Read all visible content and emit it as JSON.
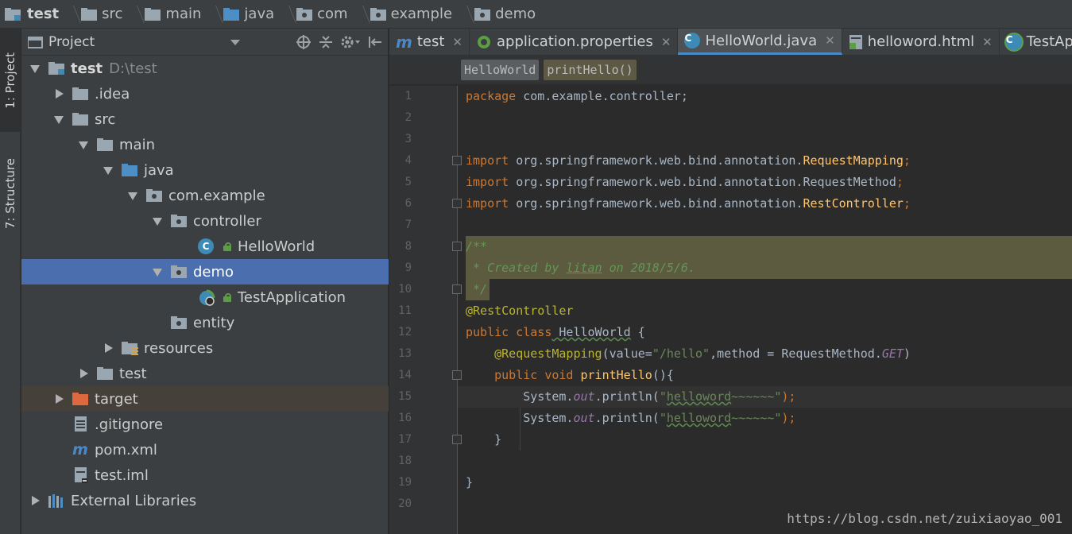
{
  "breadcrumb": [
    {
      "label": "test",
      "icon": "module-folder-icon"
    },
    {
      "label": "src",
      "icon": "folder-icon"
    },
    {
      "label": "main",
      "icon": "folder-icon"
    },
    {
      "label": "java",
      "icon": "source-folder-icon"
    },
    {
      "label": "com",
      "icon": "package-icon"
    },
    {
      "label": "example",
      "icon": "package-icon"
    },
    {
      "label": "demo",
      "icon": "package-icon"
    }
  ],
  "tool_strip": {
    "project_tab": "1: Project",
    "structure_tab": "7: Structure"
  },
  "project_panel": {
    "title": "Project",
    "tree": [
      {
        "label": "test",
        "extra": "D:\\test",
        "depth": 0,
        "arrow": "down",
        "icon": "module",
        "bold": true
      },
      {
        "label": ".idea",
        "depth": 1,
        "arrow": "right",
        "icon": "folder"
      },
      {
        "label": "src",
        "depth": 1,
        "arrow": "down",
        "icon": "folder"
      },
      {
        "label": "main",
        "depth": 2,
        "arrow": "down",
        "icon": "folder"
      },
      {
        "label": "java",
        "depth": 3,
        "arrow": "down",
        "icon": "source-folder"
      },
      {
        "label": "com.example",
        "depth": 4,
        "arrow": "down",
        "icon": "package"
      },
      {
        "label": "controller",
        "depth": 5,
        "arrow": "down",
        "icon": "package"
      },
      {
        "label": "HelloWorld",
        "depth": 6,
        "arrow": "none",
        "icon": "class"
      },
      {
        "label": "demo",
        "depth": 5,
        "arrow": "down",
        "icon": "package",
        "selected": true
      },
      {
        "label": "TestApplication",
        "depth": 6,
        "arrow": "none",
        "icon": "spring-boot-class"
      },
      {
        "label": "entity",
        "depth": 5,
        "arrow": "none",
        "icon": "package"
      },
      {
        "label": "resources",
        "depth": 3,
        "arrow": "right",
        "icon": "resources-folder"
      },
      {
        "label": "test",
        "depth": 2,
        "arrow": "right",
        "icon": "folder"
      },
      {
        "label": "target",
        "depth": 1,
        "arrow": "right",
        "icon": "excluded-folder",
        "excluded": true
      },
      {
        "label": ".gitignore",
        "depth": 1,
        "arrow": "none",
        "icon": "text-file"
      },
      {
        "label": "pom.xml",
        "depth": 1,
        "arrow": "none",
        "icon": "maven-file"
      },
      {
        "label": "test.iml",
        "depth": 1,
        "arrow": "none",
        "icon": "iml-file"
      },
      {
        "label": "External Libraries",
        "depth": 0,
        "arrow": "right",
        "icon": "libraries"
      }
    ]
  },
  "editor": {
    "tabs": [
      {
        "label": "test",
        "icon": "maven-icon",
        "active": false
      },
      {
        "label": "application.properties",
        "icon": "spring-properties-icon",
        "active": false
      },
      {
        "label": "HelloWorld.java",
        "icon": "class-icon",
        "active": true
      },
      {
        "label": "helloword.html",
        "icon": "html-icon",
        "active": false
      },
      {
        "label": "TestApp",
        "icon": "spring-boot-class-icon",
        "active": false
      }
    ],
    "breadcrumb": [
      "HelloWorld",
      "printHello()"
    ],
    "line_numbers": [
      "1",
      "2",
      "3",
      "4",
      "5",
      "6",
      "7",
      "8",
      "9",
      "10",
      "11",
      "12",
      "13",
      "14",
      "15",
      "16",
      "17",
      "18",
      "19",
      "20"
    ],
    "code": {
      "l1_kw": "package",
      "l1_rest": " com.example.controller;",
      "l4_kw": "import",
      "l4_pkg": " org.springframework.web.bind.annotation.",
      "l4_cls": "RequestMapping",
      "l4_end": ";",
      "l5_kw": "import",
      "l5_pkg": " org.springframework.web.bind.annotation.RequestMethod",
      "l5_end": ";",
      "l6_kw": "import",
      "l6_pkg": " org.springframework.web.bind.annotation.",
      "l6_cls": "RestController",
      "l6_end": ";",
      "l8": "/**",
      "l9a": " * Created by ",
      "l9b": "litan",
      "l9c": " on 2018/5/6.",
      "l10": " */",
      "l11": "@RestController",
      "l12_kw": "public class",
      "l12_name": " HelloWorld",
      "l12_end": " {",
      "l13_ann": "@RequestMapping",
      "l13_a": "(value=",
      "l13_str": "\"/hello\"",
      "l13_b": ",method = RequestMethod.",
      "l13_get": "GET",
      "l13_c": ")",
      "l14_kw": "public void",
      "l14_fn": " printHello",
      "l14_end": "(){",
      "l15_a": "System.",
      "l15_out": "out",
      "l15_b": ".println(",
      "l15_q1": "\"",
      "l15_str": "helloword",
      "l15_tail": "~~~~~~\"",
      "l15_end": ");",
      "l16_a": "System.",
      "l16_out": "out",
      "l16_b": ".println(",
      "l16_q1": "\"",
      "l16_str": "helloword",
      "l16_tail": "~~~~~~\"",
      "l16_end": ");",
      "l17": "}",
      "l19": "}"
    },
    "watermark": "https://blog.csdn.net/zuixiaoyao_001"
  },
  "colors": {
    "selection": "#4b6eaf",
    "keyword": "#cc7832",
    "annotation": "#bbb529",
    "string": "#6a8759",
    "comment": "#629755"
  }
}
